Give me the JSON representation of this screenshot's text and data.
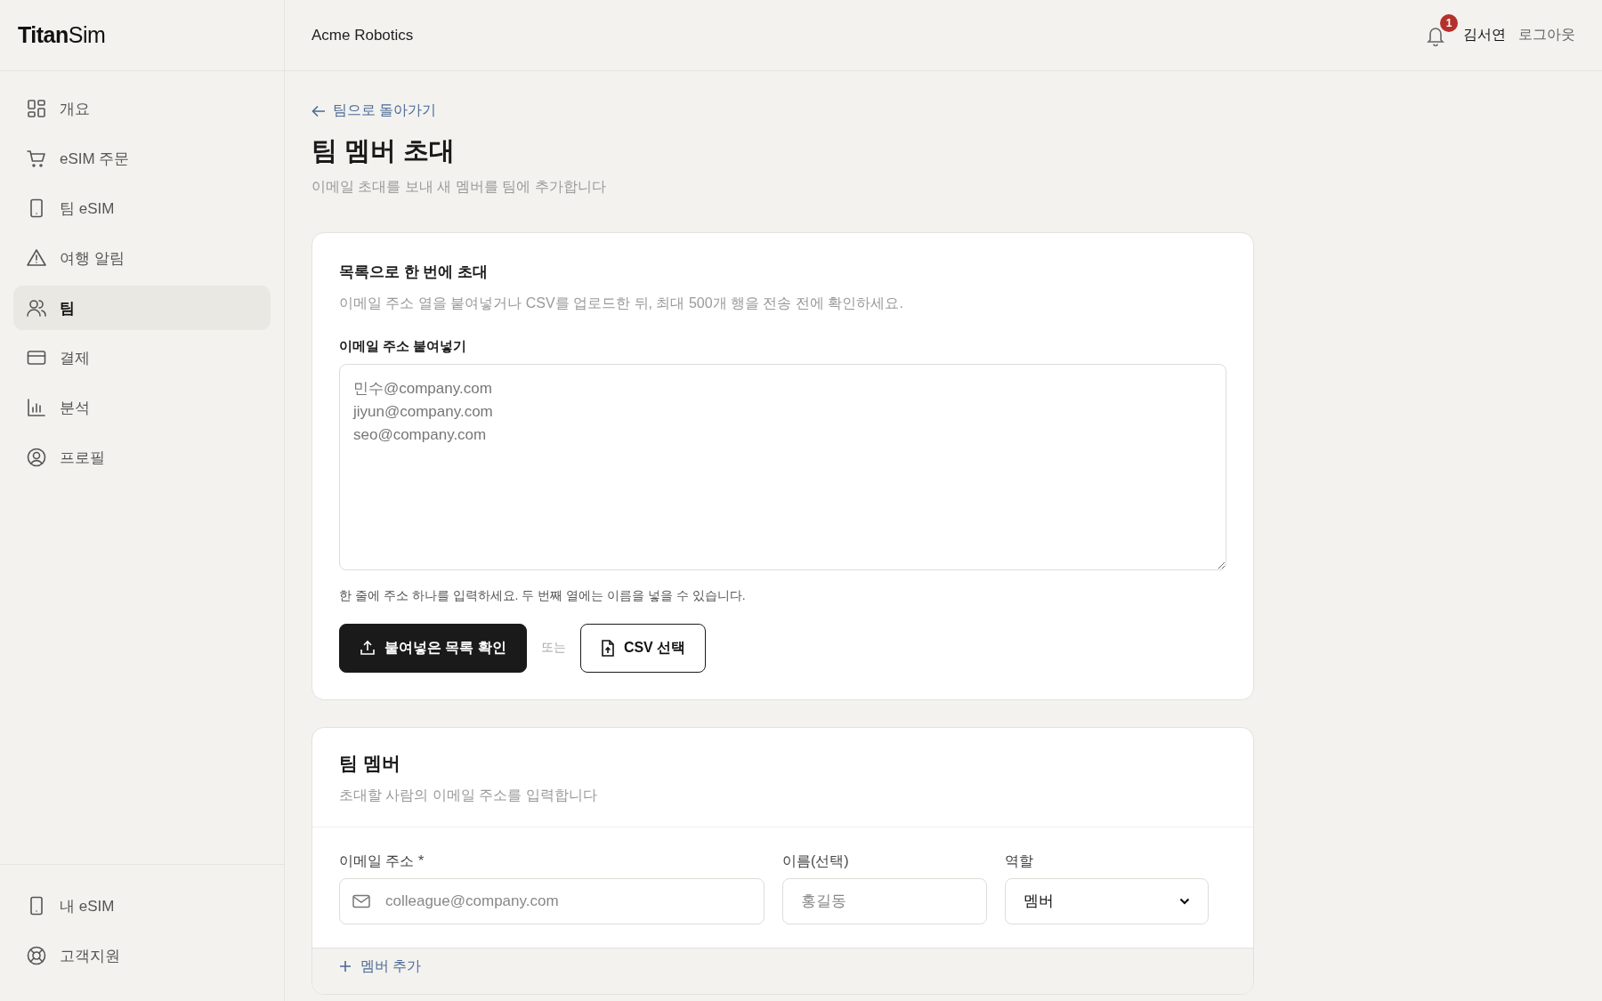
{
  "brand": "**Titan**Sim",
  "header": {
    "org": "Acme Robotics",
    "notifications": "1",
    "user": "김서연",
    "logout": "로그아웃"
  },
  "sidebar": {
    "items": [
      {
        "label": "개요",
        "selected": false
      },
      {
        "label": "eSIM 주문",
        "selected": false
      },
      {
        "label": "팀 eSIM",
        "selected": false
      },
      {
        "label": "여행 알림",
        "selected": false
      },
      {
        "label": "팀",
        "selected": true
      },
      {
        "label": "결제",
        "selected": false
      },
      {
        "label": "분석",
        "selected": false
      },
      {
        "label": "프로필",
        "selected": false
      }
    ],
    "bottom_items": [
      {
        "label": "내 eSIM",
        "selected": false
      },
      {
        "label": "고객지원",
        "selected": false
      }
    ]
  },
  "back_link": "팀으로 돌아가기",
  "page_title": "팀 멤버 초대",
  "page_subtitle": "이메일 초대를 보내 새 멤버를 팀에 추가합니다",
  "bulk_card": {
    "title": "목록으로 한 번에 초대",
    "description": "이메일 주소 열을 붙여넣거나 CSV를 업로드한 뒤, 최대 500개 행을 전송 전에 확인하세요.",
    "field_label": "이메일 주소 붙여넣기",
    "placeholder": "민수@company.com\njiyun@company.com\nseo@company.com",
    "hint": "한 줄에 주소 하나를 입력하세요. 두 번째 열에는 이름을 넣을 수 있습니다.",
    "primary_button": "붙여넣은 목록 확인",
    "separator": "또는",
    "secondary_button": "CSV 선택"
  },
  "members_card": {
    "title": "팀 멤버",
    "description": "초대할 사람의 이메일 주소를 입력합니다",
    "fields": [
      {
        "kind": "email",
        "label": "이메일 주소 *",
        "placeholder": "colleague@company.com"
      },
      {
        "kind": "text",
        "label": "이름(선택)",
        "placeholder": "홍길동"
      },
      {
        "kind": "select",
        "label": "역할",
        "value": "멤버"
      }
    ],
    "add_button": "멤버 추가"
  }
}
